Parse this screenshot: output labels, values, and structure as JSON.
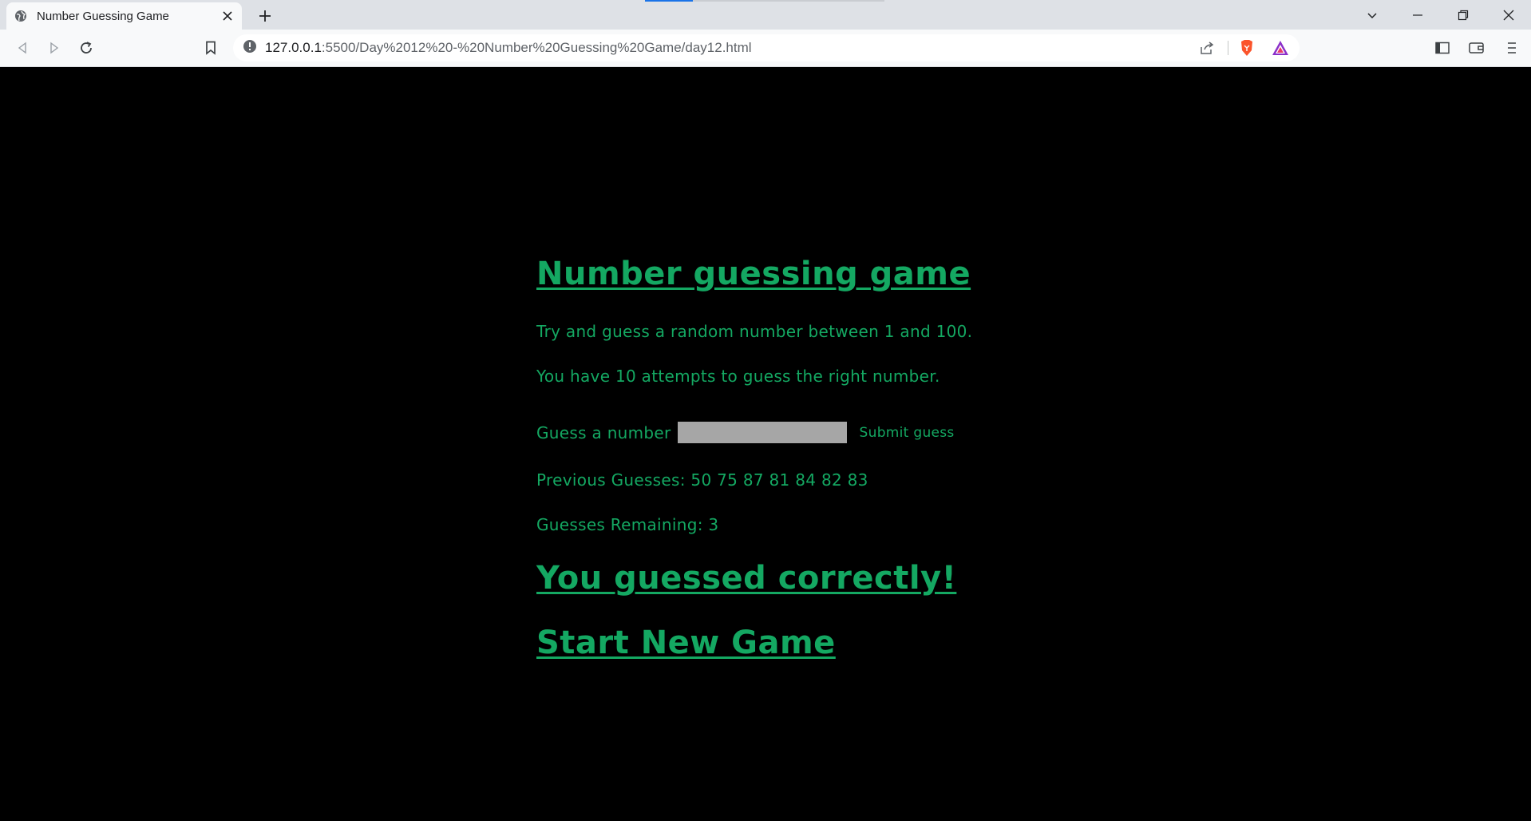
{
  "browser": {
    "tab": {
      "title": "Number Guessing Game",
      "favicon": "globe-icon"
    },
    "address": {
      "host": "127.0.0.1",
      "path": ":5500/Day%2012%20-%20Number%20Guessing%20Game/day12.html"
    }
  },
  "page": {
    "title": "Number guessing game",
    "intro_1": "Try and guess a random number between 1 and 100.",
    "intro_2": "You have 10 attempts to guess the right number.",
    "guess_label": "Guess a number",
    "guess_value": "",
    "submit_label": "Submit guess",
    "previous_guesses": "Previous Guesses: 50 75 87 81 84 82 83",
    "remaining": "Guesses Remaining: 3",
    "result": "You guessed correctly!",
    "new_game": "Start New Game"
  },
  "colors": {
    "accent": "#14a862",
    "background": "#000000",
    "input_bg": "#a6a6a6"
  }
}
